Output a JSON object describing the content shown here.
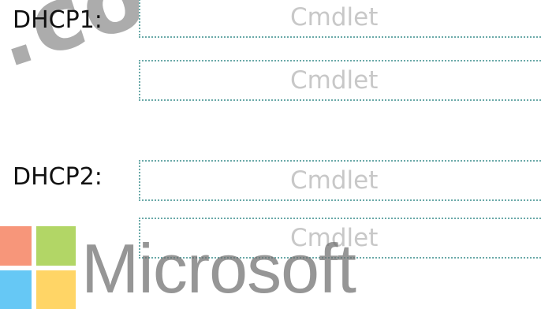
{
  "rows": [
    {
      "label": "DHCP1:",
      "slots": [
        "Cmdlet",
        "Cmdlet"
      ]
    },
    {
      "label": "DHCP2:",
      "slots": [
        "Cmdlet",
        "Cmdlet"
      ]
    }
  ],
  "watermark": {
    "site_text": ".com",
    "logo_word": "Microsoft",
    "logo_colors": [
      "#f25022",
      "#7fba00",
      "#00a4ef",
      "#ffb900"
    ]
  },
  "colors": {
    "slot_border": "#6aa9a8",
    "placeholder_text": "#c8c8c8"
  }
}
